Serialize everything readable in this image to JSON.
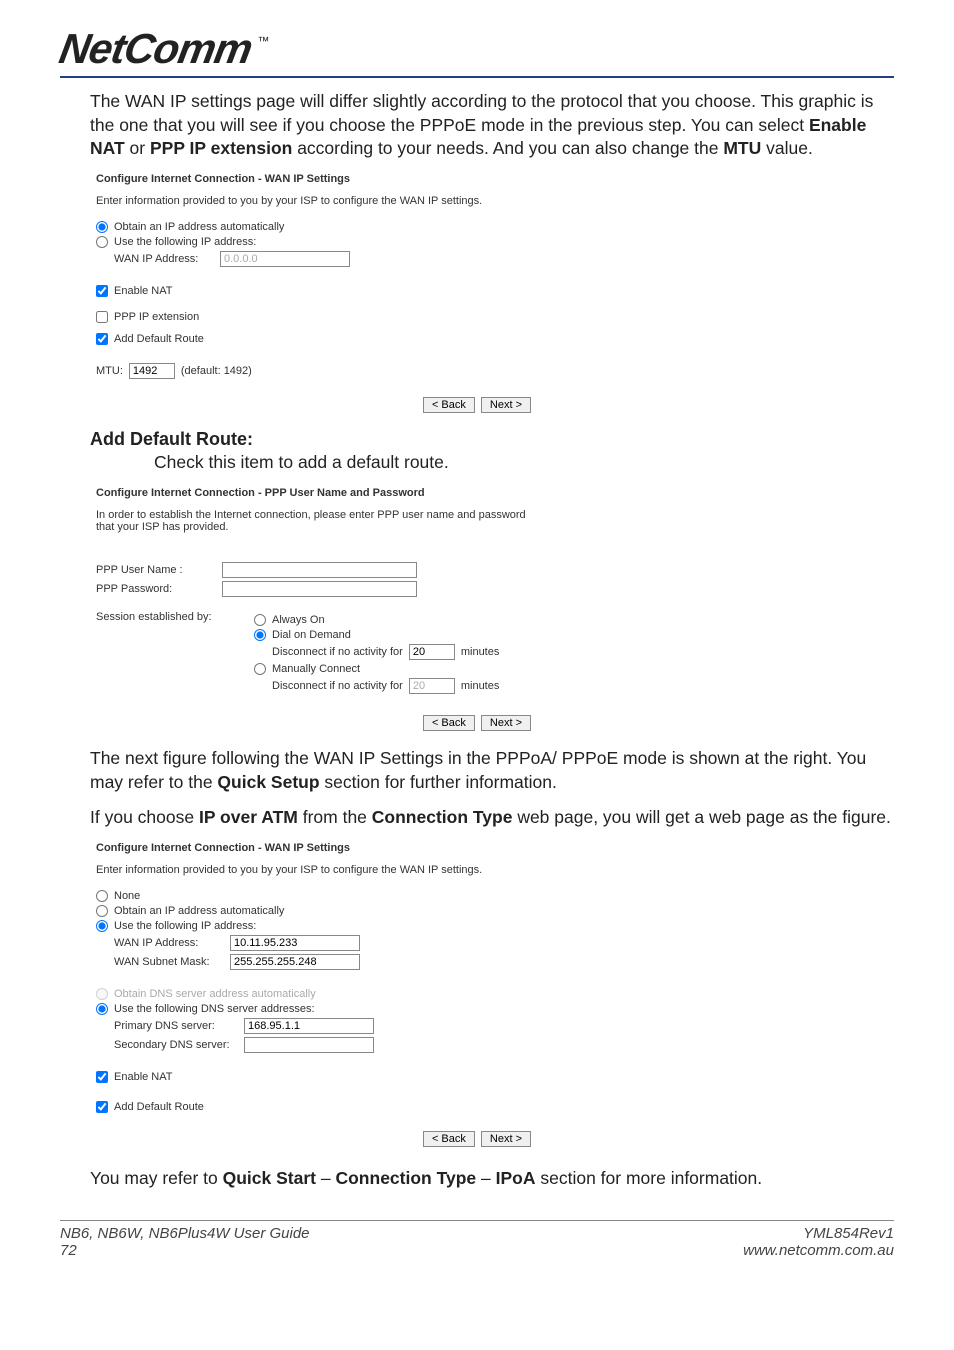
{
  "brand": {
    "name": "NetComm",
    "tm": "™"
  },
  "para1_a": "The WAN IP settings page will differ slightly according to the protocol that you choose. This graphic is the one that you will see if you choose the PPPoE mode in the previous step. You can select ",
  "para1_b": "Enable NAT",
  "para1_c": " or ",
  "para1_d": "PPP IP extension",
  "para1_e": " according to your needs. And you can also change the ",
  "para1_f": "MTU",
  "para1_g": " value.",
  "panel1": {
    "title": "Configure Internet Connection - WAN IP Settings",
    "desc": "Enter information provided to you by your ISP to configure the WAN IP settings.",
    "opt_auto": "Obtain an IP address automatically",
    "opt_static": "Use the following IP address:",
    "wanip_label": "WAN IP Address:",
    "wanip_value": "0.0.0.0",
    "enable_nat": "Enable NAT",
    "ppp_ext": "PPP IP extension",
    "add_route": "Add Default Route",
    "mtu_label": "MTU:",
    "mtu_value": "1492",
    "mtu_default": "(default: 1492)",
    "back": "< Back",
    "next": "Next >"
  },
  "hd_add_route": "Add Default Route:",
  "hd_add_route_sub": "Check this item to add a default route.",
  "panel2": {
    "title": "Configure Internet Connection - PPP User Name and Password",
    "desc": "In order to establish the Internet connection, please enter PPP user name and password that your ISP has provided.",
    "user_label": "PPP User Name :",
    "pass_label": "PPP Password:",
    "session_label": "Session established by:",
    "always_on": "Always On",
    "dial": "Dial on Demand",
    "disc_if": "Disconnect if no activity for",
    "disc_val": "20",
    "minutes": "minutes",
    "manual": "Manually Connect",
    "back": "< Back",
    "next": "Next >"
  },
  "para2_a": "The next figure following the WAN IP Settings in the PPPoA/ PPPoE mode is shown at the right. You may refer to the ",
  "para2_b": "Quick Setup",
  "para2_c": " section for further information.",
  "para3_a": "If you choose ",
  "para3_b": "IP over ATM",
  "para3_c": " from the ",
  "para3_d": "Connection Type",
  "para3_e": " web page, you will get a web page as the figure.",
  "panel3": {
    "title": "Configure Internet Connection - WAN IP Settings",
    "desc": "Enter information provided to you by your ISP to configure the WAN IP settings.",
    "opt_none": "None",
    "opt_auto": "Obtain an IP address automatically",
    "opt_static": "Use the following IP address:",
    "wanip_label": "WAN IP Address:",
    "wanip_value": "10.11.95.233",
    "mask_label": "WAN Subnet Mask:",
    "mask_value": "255.255.255.248",
    "dns_auto": "Obtain DNS server address automatically",
    "dns_static": "Use the following DNS server addresses:",
    "pri_dns_label": "Primary DNS server:",
    "pri_dns_value": "168.95.1.1",
    "sec_dns_label": "Secondary DNS server:",
    "sec_dns_value": "",
    "enable_nat": "Enable NAT",
    "add_route": "Add Default Route",
    "back": "< Back",
    "next": "Next >"
  },
  "para4_a": "You may refer to ",
  "para4_b": "Quick Start",
  "para4_c": " – ",
  "para4_d": "Connection Type",
  "para4_e": " – ",
  "para4_f": "IPoA",
  "para4_g": " section for more information.",
  "footer": {
    "left1": "NB6, NB6W, NB6Plus4W User Guide",
    "left2": "72",
    "right1": "YML854Rev1",
    "right2": "www.netcomm.com.au"
  }
}
